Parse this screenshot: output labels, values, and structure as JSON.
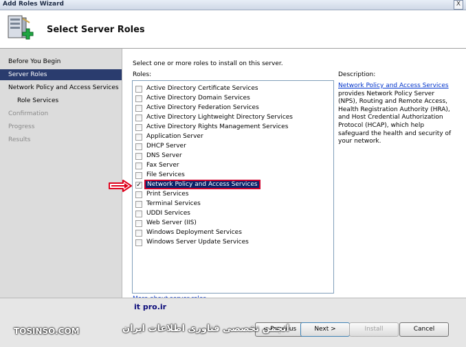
{
  "window": {
    "title": "Add Roles Wizard",
    "close_glyph": "X"
  },
  "header": {
    "page_title": "Select Server Roles",
    "icon": "server-add-icon"
  },
  "nav": {
    "items": [
      {
        "label": "Before You Begin",
        "state": "normal"
      },
      {
        "label": "Server Roles",
        "state": "selected"
      },
      {
        "label": "Network Policy and Access Services",
        "state": "normal"
      },
      {
        "label": "Role Services",
        "state": "sub"
      },
      {
        "label": "Confirmation",
        "state": "disabled"
      },
      {
        "label": "Progress",
        "state": "disabled"
      },
      {
        "label": "Results",
        "state": "disabled"
      }
    ]
  },
  "main": {
    "instruction": "Select one or more roles to install on this server.",
    "roles_label": "Roles:",
    "roles": [
      {
        "label": "Active Directory Certificate Services",
        "checked": false
      },
      {
        "label": "Active Directory Domain Services",
        "checked": false
      },
      {
        "label": "Active Directory Federation Services",
        "checked": false
      },
      {
        "label": "Active Directory Lightweight Directory Services",
        "checked": false
      },
      {
        "label": "Active Directory Rights Management Services",
        "checked": false
      },
      {
        "label": "Application Server",
        "checked": false
      },
      {
        "label": "DHCP Server",
        "checked": false
      },
      {
        "label": "DNS Server",
        "checked": false
      },
      {
        "label": "Fax Server",
        "checked": false
      },
      {
        "label": "File Services",
        "checked": false
      },
      {
        "label": "Network Policy and Access Services",
        "checked": true
      },
      {
        "label": "Print Services",
        "checked": false
      },
      {
        "label": "Terminal Services",
        "checked": false
      },
      {
        "label": "UDDI Services",
        "checked": false
      },
      {
        "label": "Web Server (IIS)",
        "checked": false
      },
      {
        "label": "Windows Deployment Services",
        "checked": false
      },
      {
        "label": "Windows Server Update Services",
        "checked": false
      }
    ],
    "checkmark": "✓",
    "description_label": "Description:",
    "description_link": "Network Policy and Access Services",
    "description_text": " provides Network Policy Server (NPS), Routing and Remote Access, Health Registration Authority (HRA), and Host Credential Authorization Protocol (HCAP), which help safeguard the health and security of your network.",
    "more_link": "More about server roles"
  },
  "buttons": {
    "previous": "< Previous",
    "next": "Next >",
    "install": "Install",
    "cancel": "Cancel"
  },
  "watermarks": {
    "itpro": "it pro.ir",
    "tosinso": "TOSINSO.COM",
    "persian": "انجمن تخصصی فناوری اطلاعات ایران"
  },
  "colors": {
    "selection": "#0a246a",
    "nav_selected": "#2a3c6e",
    "highlight_outline": "#d0002a",
    "arrow": "#e0001b",
    "link": "#0033cc"
  }
}
